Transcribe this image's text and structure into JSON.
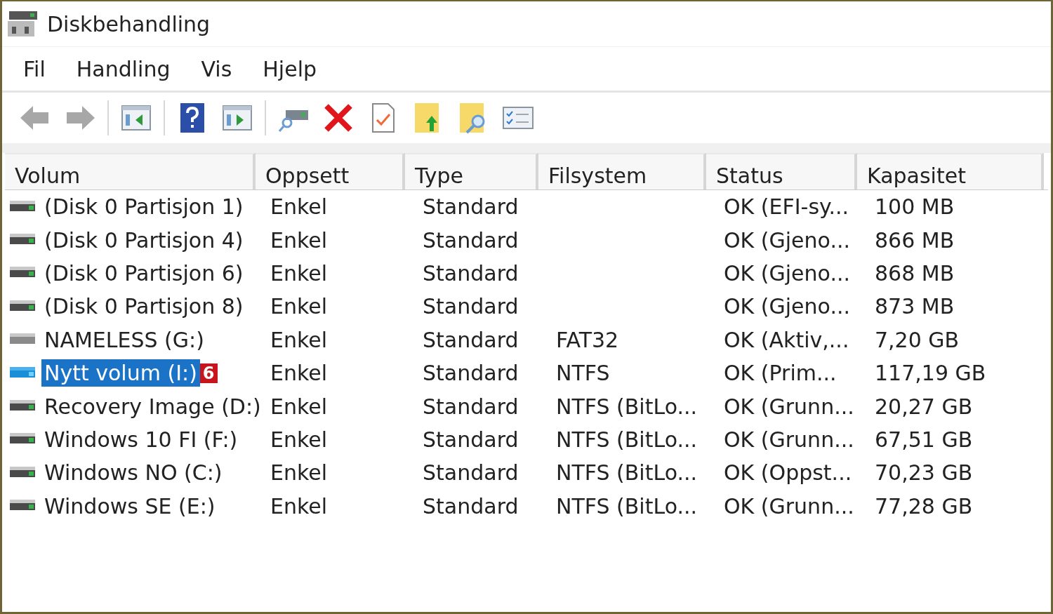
{
  "window": {
    "title": "Diskbehandling"
  },
  "menu": [
    "Fil",
    "Handling",
    "Vis",
    "Hjelp"
  ],
  "toolbar": [
    [
      {
        "kind": "back",
        "disabled": true
      },
      {
        "kind": "forward",
        "disabled": true
      }
    ],
    [
      {
        "kind": "console-left",
        "disabled": false
      }
    ],
    [
      {
        "kind": "help",
        "disabled": false
      },
      {
        "kind": "console-right",
        "disabled": false
      }
    ],
    [
      {
        "kind": "connect",
        "disabled": false
      },
      {
        "kind": "delete",
        "disabled": false
      },
      {
        "kind": "properties",
        "disabled": false
      },
      {
        "kind": "folder-up",
        "disabled": false
      },
      {
        "kind": "folder-search",
        "disabled": false
      },
      {
        "kind": "checklist",
        "disabled": false
      }
    ]
  ],
  "table": {
    "columns": [
      "Volum",
      "Oppsett",
      "Type",
      "Filsystem",
      "Status",
      "Kapasitet"
    ],
    "rows": [
      {
        "kind": "disk",
        "selected": false,
        "cells": [
          "(Disk 0 Partisjon 1)",
          "Enkel",
          "Standard",
          "",
          "OK (EFI-sy...",
          "100 MB"
        ]
      },
      {
        "kind": "disk",
        "selected": false,
        "cells": [
          "(Disk 0 Partisjon 4)",
          "Enkel",
          "Standard",
          "",
          "OK (Gjeno...",
          "866 MB"
        ]
      },
      {
        "kind": "disk",
        "selected": false,
        "cells": [
          "(Disk 0 Partisjon 6)",
          "Enkel",
          "Standard",
          "",
          "OK (Gjeno...",
          "868 MB"
        ]
      },
      {
        "kind": "disk",
        "selected": false,
        "cells": [
          "(Disk 0 Partisjon 8)",
          "Enkel",
          "Standard",
          "",
          "OK (Gjeno...",
          "873 MB"
        ]
      },
      {
        "kind": "removable",
        "selected": false,
        "cells": [
          "NAMELESS (G:)",
          "Enkel",
          "Standard",
          "FAT32",
          "OK (Aktiv,...",
          "7,20 GB"
        ]
      },
      {
        "kind": "disk",
        "selected": true,
        "badge": "6",
        "cells": [
          "Nytt volum (I:)",
          "Enkel",
          "Standard",
          "NTFS",
          "OK (Prim...",
          "117,19 GB"
        ]
      },
      {
        "kind": "disk",
        "selected": false,
        "cells": [
          "Recovery Image (D:)",
          "Enkel",
          "Standard",
          "NTFS (BitLo...",
          "OK (Grunn...",
          "20,27 GB"
        ]
      },
      {
        "kind": "disk",
        "selected": false,
        "cells": [
          "Windows 10 FI (F:)",
          "Enkel",
          "Standard",
          "NTFS (BitLo...",
          "OK (Grunn...",
          "67,51 GB"
        ]
      },
      {
        "kind": "disk",
        "selected": false,
        "cells": [
          "Windows NO (C:)",
          "Enkel",
          "Standard",
          "NTFS (BitLo...",
          "OK (Oppst...",
          "70,23 GB"
        ]
      },
      {
        "kind": "disk",
        "selected": false,
        "cells": [
          "Windows SE (E:)",
          "Enkel",
          "Standard",
          "NTFS (BitLo...",
          "OK (Grunn...",
          "77,28 GB"
        ]
      }
    ]
  }
}
